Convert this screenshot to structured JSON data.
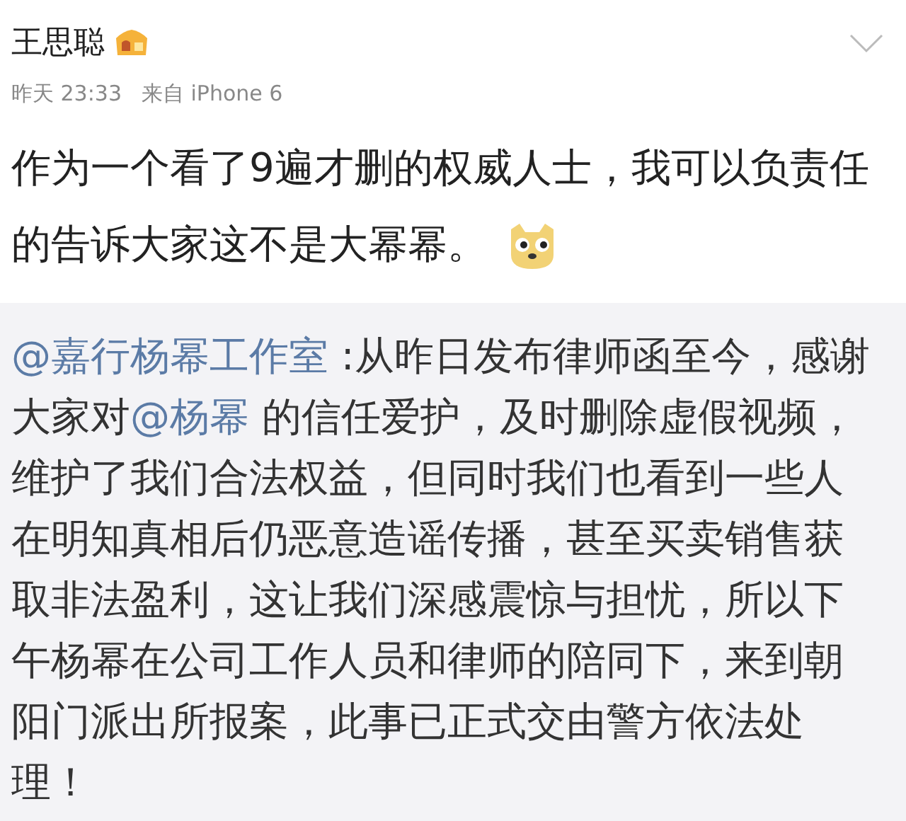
{
  "post": {
    "author": "王思聪",
    "time": "昨天 23:33",
    "source": "来自 iPhone 6",
    "text": "作为一个看了9遍才删的权威人士，我可以负责任的告诉大家这不是大幂幂。"
  },
  "repost": {
    "segments": [
      {
        "kind": "mention",
        "text": "@嘉行杨幂工作室"
      },
      {
        "kind": "text",
        "text": " :从昨日发布律师函至今，感谢大家对"
      },
      {
        "kind": "mention",
        "text": "@杨幂"
      },
      {
        "kind": "text",
        "text": " 的信任爱护，及时删除虚假视频，维护了我们合法权益，但同时我们也看到一些人在明知真相后仍恶意造谣传播，甚至买卖销售获取非法盈利，这让我们深感震惊与担忧，所以下午杨幂在公司工作人员和律师的陪同下，来到朝阳门派出所报案，此事已正式交由警方依法处理！"
      }
    ]
  }
}
